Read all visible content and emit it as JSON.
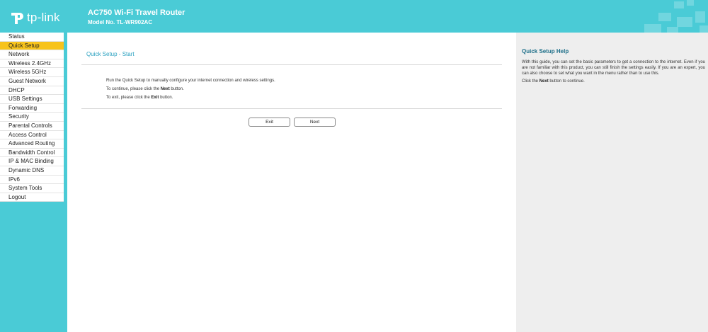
{
  "header": {
    "logo_text": "tp-link",
    "title": "AC750 Wi-Fi Travel Router",
    "model": "Model No. TL-WR902AC"
  },
  "sidebar": {
    "items": [
      {
        "label": "Status"
      },
      {
        "label": "Quick Setup"
      },
      {
        "label": "Network"
      },
      {
        "label": "Wireless 2.4GHz"
      },
      {
        "label": "Wireless 5GHz"
      },
      {
        "label": "Guest Network"
      },
      {
        "label": "DHCP"
      },
      {
        "label": "USB Settings"
      },
      {
        "label": "Forwarding"
      },
      {
        "label": "Security"
      },
      {
        "label": "Parental Controls"
      },
      {
        "label": "Access Control"
      },
      {
        "label": "Advanced Routing"
      },
      {
        "label": "Bandwidth Control"
      },
      {
        "label": "IP & MAC Binding"
      },
      {
        "label": "Dynamic DNS"
      },
      {
        "label": "IPv6"
      },
      {
        "label": "System Tools"
      },
      {
        "label": "Logout"
      }
    ],
    "active_index": 1
  },
  "main": {
    "title": "Quick Setup - Start",
    "line1": "Run the Quick Setup to manually configure your internet connection and wireless settings.",
    "line2_pre": "To continue, please click the",
    "line2_bold": "Next",
    "line2_post": "button.",
    "line3_pre": "To exit, please click the",
    "line3_bold": "Exit",
    "line3_post": "button.",
    "exit_label": "Exit",
    "next_label": "Next"
  },
  "help": {
    "title": "Quick Setup Help",
    "text": "With this guide, you can set the basic parameters to get a connection to the internet. Even if you are not familiar with this product, you can still finish the settings easily. If you are an expert, you can also choose to set what you want in the menu rather than to use this.",
    "text2_pre": "Click the",
    "text2_bold": "Next",
    "text2_post": "button to continue."
  },
  "colors": {
    "brand": "#4acbd6",
    "active_menu": "#f7c31b",
    "title_blue": "#2aa1c0",
    "help_title": "#1e6f89"
  }
}
